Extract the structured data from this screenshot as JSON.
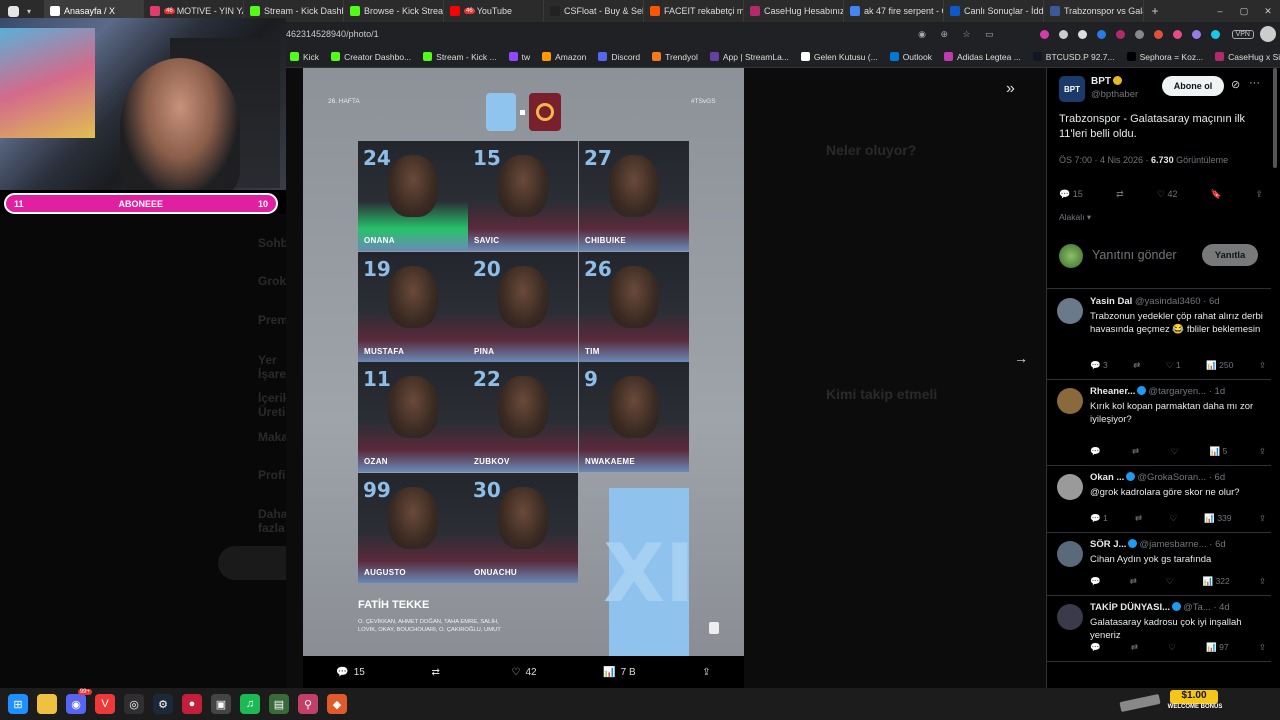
{
  "browser": {
    "tabs": [
      {
        "label": "Anasayfa / X",
        "color": "#ffffff",
        "active": true
      },
      {
        "label": "MOTIVE - YIN YANG",
        "color": "#e33b6d",
        "badge": "46"
      },
      {
        "label": "Stream - Kick Dashbo",
        "color": "#53fc18"
      },
      {
        "label": "Browse - Kick Stream",
        "color": "#53fc18"
      },
      {
        "label": "YouTube",
        "color": "#ff0000",
        "badge": "46"
      },
      {
        "label": "CSFloat - Buy & Sell C",
        "color": "#222222"
      },
      {
        "label": "FACEIT rekabetçi maç",
        "color": "#ff5500"
      },
      {
        "label": "CaseHug Hesabınız -",
        "color": "#b32a6a"
      },
      {
        "label": "ak 47 fire serpent - G",
        "color": "#4285f4"
      },
      {
        "label": "Canlı Sonuçlar - İddaa",
        "color": "#0a5ac9"
      },
      {
        "label": "Trabzonspor vs Galat",
        "color": "#3b5998"
      }
    ],
    "address": "462314528940/photo/1",
    "bookmarks": [
      {
        "label": "Kick",
        "color": "#53fc18"
      },
      {
        "label": "Creator Dashbo...",
        "color": "#53fc18"
      },
      {
        "label": "Stream - Kick ...",
        "color": "#53fc18"
      },
      {
        "label": "tw",
        "color": "#9146ff"
      },
      {
        "label": "Amazon",
        "color": "#ff9900"
      },
      {
        "label": "Discord",
        "color": "#5865f2"
      },
      {
        "label": "Trendyol",
        "color": "#f27a1a"
      },
      {
        "label": "App | StreamLa...",
        "color": "#6441a5"
      },
      {
        "label": "Gelen Kutusu (...",
        "color": "#ffffff"
      },
      {
        "label": "Outlook",
        "color": "#0078d4"
      },
      {
        "label": "Adidas Legtea ...",
        "color": "#c13ab0"
      },
      {
        "label": "BTCUSD.P 92.7...",
        "color": "#131722"
      },
      {
        "label": "Sephora = Koz...",
        "color": "#000000"
      },
      {
        "label": "CaseHug x Sin...",
        "color": "#b32a6a"
      }
    ]
  },
  "overlay": {
    "sub_left": "11",
    "sub_label": "ABONEEE",
    "sub_right": "10"
  },
  "photo": {
    "week": "26. HAFTA",
    "hashtag": "#TSvGS",
    "coach": "FATİH TEKKE",
    "subs_line1": "O. ÇEVİKKAN, AHMET DOĞAN, TAHA EMRE, SALİH,",
    "subs_line2": "LOVIK, OKAY, BOUCHOUARI, O. ÇAKIROĞLU, UMUT",
    "xi": "XI",
    "players": [
      {
        "num": "24",
        "name": "ONANA",
        "kit": "#27c26a"
      },
      {
        "num": "15",
        "name": "SAVIC",
        "kit": "#5a2a3a"
      },
      {
        "num": "27",
        "name": "CHIBUIKE",
        "kit": "#5a2a3a"
      },
      {
        "num": "19",
        "name": "MUSTAFA",
        "kit": "#5a2a3a"
      },
      {
        "num": "20",
        "name": "PINA",
        "kit": "#5a2a3a"
      },
      {
        "num": "26",
        "name": "TIM",
        "kit": "#5a2a3a"
      },
      {
        "num": "11",
        "name": "OZAN",
        "kit": "#5a2a3a"
      },
      {
        "num": "22",
        "name": "ZUBKOV",
        "kit": "#5a2a3a"
      },
      {
        "num": "9",
        "name": "NWAKAEME",
        "kit": "#5a2a3a"
      },
      {
        "num": "99",
        "name": "AUGUSTO",
        "kit": "#5a2a3a"
      },
      {
        "num": "30",
        "name": "ONUACHU",
        "kit": "#5a2a3a"
      }
    ],
    "actions": {
      "replies": "15",
      "retweets": "",
      "likes": "42",
      "views": "7 B"
    }
  },
  "tweet": {
    "author": "BPT",
    "handle": "@bpthaber",
    "follow": "Abone ol",
    "text": "Trabzonspor - Galatasaray maçının ilk 11'leri belli oldu.",
    "time": "ÖS 7:00 · 4 Nis 2026 · ",
    "views_count": "6.730",
    "views_label": " Görüntüleme",
    "replies": "15",
    "likes": "42",
    "sort": "Alakalı",
    "reply_placeholder": "Yanıtını gönder",
    "reply_button": "Yanıtla"
  },
  "replies": [
    {
      "name": "Yasin Dal",
      "handle": "@yasindal3460 · 6d",
      "text": "Trabzonun yedekler çöp rahat alırız derbi havasında geçmez 😂 fbliler beklemesin",
      "verified": false,
      "stats": [
        "3",
        "",
        "1",
        "250"
      ],
      "avatar": "#6b7a8a"
    },
    {
      "name": "Rheaner...",
      "handle": "@targaryen... · 1d",
      "text": "Kırık kol kopan parmaktan daha mı zor iyileşiyor?",
      "verified": true,
      "stats": [
        "",
        "",
        "",
        "5"
      ],
      "avatar": "#8a6a3a"
    },
    {
      "name": "Okan ...",
      "handle": "@GrokaSoran... · 6d",
      "text": "@grok kadrolara göre skor ne olur?",
      "verified": true,
      "stats": [
        "1",
        "",
        "",
        "339"
      ],
      "avatar": "#9a9a9a"
    },
    {
      "name": "SÖR J...",
      "handle": "@jamesbarne... · 6d",
      "text": "Cihan Aydın yok gs tarafında",
      "verified": true,
      "stats": [
        "",
        "",
        "",
        "322"
      ],
      "avatar": "#5a6a7a"
    },
    {
      "name": "TAKİP DÜNYASI...",
      "handle": "@Ta... · 4d",
      "text": "Galatasaray kadrosu çok iyi inşallah yeneriz",
      "verified": true,
      "stats": [
        "",
        "",
        "",
        "97"
      ],
      "avatar": "#3a3a4a"
    }
  ],
  "taskbar": {
    "discord_badge": "99+",
    "promo_amount": "$1.00",
    "promo_label": "WELCOME BONUS"
  }
}
